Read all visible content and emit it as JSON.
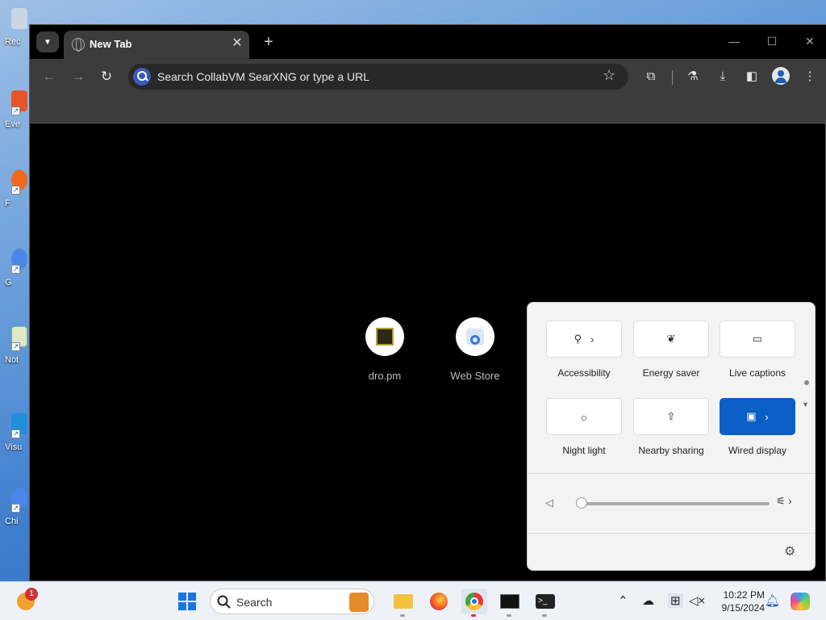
{
  "desktop": {
    "icons": [
      {
        "label": "Rec"
      },
      {
        "label": "Eve"
      },
      {
        "label": "F"
      },
      {
        "label": "G"
      },
      {
        "label": "Not"
      },
      {
        "label": "Visu"
      },
      {
        "label": "Chi"
      }
    ]
  },
  "browser": {
    "tab_title": "New Tab",
    "close_glyph": "✕",
    "newtab_glyph": "+",
    "omnibox_placeholder": "Search CollabVM SearXNG or type a URL",
    "window_controls": {
      "minimize": "—",
      "maximize": "☐",
      "close": "✕"
    },
    "shortcuts": [
      {
        "label": "dro.pm"
      },
      {
        "label": "Web Store"
      }
    ]
  },
  "quick_settings": {
    "tiles": [
      {
        "label": "Accessibility",
        "icon": "accessibility-icon",
        "active": false,
        "has_chevron": true
      },
      {
        "label": "Energy saver",
        "icon": "leaf-icon",
        "active": false,
        "has_chevron": false
      },
      {
        "label": "Live captions",
        "icon": "captions-icon",
        "active": false,
        "has_chevron": false
      },
      {
        "label": "Night light",
        "icon": "sun-icon",
        "active": false,
        "has_chevron": false
      },
      {
        "label": "Nearby sharing",
        "icon": "share-icon",
        "active": false,
        "has_chevron": false
      },
      {
        "label": "Wired display",
        "icon": "cast-icon",
        "active": true,
        "has_chevron": true
      }
    ],
    "volume_level": 0,
    "accent": "#0a5fc6"
  },
  "taskbar": {
    "search_placeholder": "Search",
    "notification_count": "1",
    "clock_time": "10:22 PM",
    "clock_date": "9/15/2024"
  }
}
